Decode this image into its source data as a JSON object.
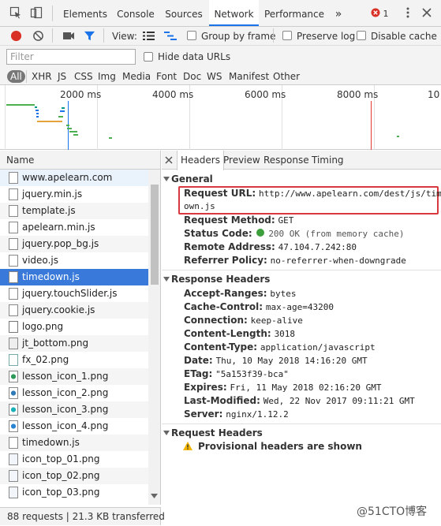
{
  "tabs": {
    "items": [
      "Elements",
      "Console",
      "Sources",
      "Network",
      "Performance"
    ],
    "more": "»",
    "error_count": "1"
  },
  "toolbar": {
    "view_label": "View:",
    "group_by_frame": "Group by frame",
    "preserve_log": "Preserve log",
    "disable_cache": "Disable cache"
  },
  "filter": {
    "placeholder": "Filter",
    "hide_data_urls": "Hide data URLs"
  },
  "types": [
    "All",
    "XHR",
    "JS",
    "CSS",
    "Img",
    "Media",
    "Font",
    "Doc",
    "WS",
    "Manifest",
    "Other"
  ],
  "overview": {
    "ticks": [
      "2000 ms",
      "4000 ms",
      "6000 ms",
      "8000 ms",
      "10"
    ]
  },
  "list": {
    "header": "Name",
    "rows": [
      "www.apelearn.com",
      "jquery.min.js",
      "template.js",
      "apelearn.min.js",
      "jquery.pop_bg.js",
      "video.js",
      "timedown.js",
      "jquery.touchSlider.js",
      "jquery.cookie.js",
      "logo.png",
      "jt_bottom.png",
      "fx_02.png",
      "lesson_icon_1.png",
      "lesson_icon_2.png",
      "lesson_icon_3.png",
      "lesson_icon_4.png",
      "timedown.js",
      "icon_top_01.png",
      "icon_top_02.png",
      "icon_top_03.png"
    ],
    "status": "88 requests | 21.3 KB transferred"
  },
  "detail": {
    "tabs": [
      "Headers",
      "Preview",
      "Response",
      "Timing"
    ],
    "general": {
      "title": "General",
      "request_url_key": "Request URL:",
      "request_url_line1": "http://www.apelearn.com/dest/js/timed",
      "request_url_line2": "own.js",
      "method_key": "Request Method:",
      "method": "GET",
      "status_key": "Status Code:",
      "status": "200 OK (from memory cache)",
      "remote_key": "Remote Address:",
      "remote": "47.104.7.242:80",
      "referrer_key": "Referrer Policy:",
      "referrer": "no-referrer-when-downgrade"
    },
    "response_headers": {
      "title": "Response Headers",
      "items": [
        {
          "k": "Accept-Ranges:",
          "v": "bytes"
        },
        {
          "k": "Cache-Control:",
          "v": "max-age=43200"
        },
        {
          "k": "Connection:",
          "v": "keep-alive"
        },
        {
          "k": "Content-Length:",
          "v": "3018"
        },
        {
          "k": "Content-Type:",
          "v": "application/javascript"
        },
        {
          "k": "Date:",
          "v": "Thu, 10 May 2018 14:16:20 GMT"
        },
        {
          "k": "ETag:",
          "v": "\"5a153f39-bca\""
        },
        {
          "k": "Expires:",
          "v": "Fri, 11 May 2018 02:16:20 GMT"
        },
        {
          "k": "Last-Modified:",
          "v": "Wed, 22 Nov 2017 09:11:21 GMT"
        },
        {
          "k": "Server:",
          "v": "nginx/1.12.2"
        }
      ]
    },
    "request_headers": {
      "title": "Request Headers",
      "warning": "Provisional headers are shown"
    }
  },
  "watermark": "@51CTO博客",
  "colors": {
    "accent": "#1a73e8",
    "selected_row": "#3879d9",
    "status_ok": "#3c9f3c",
    "url_outline": "#d9393e",
    "record": "#d93025"
  }
}
